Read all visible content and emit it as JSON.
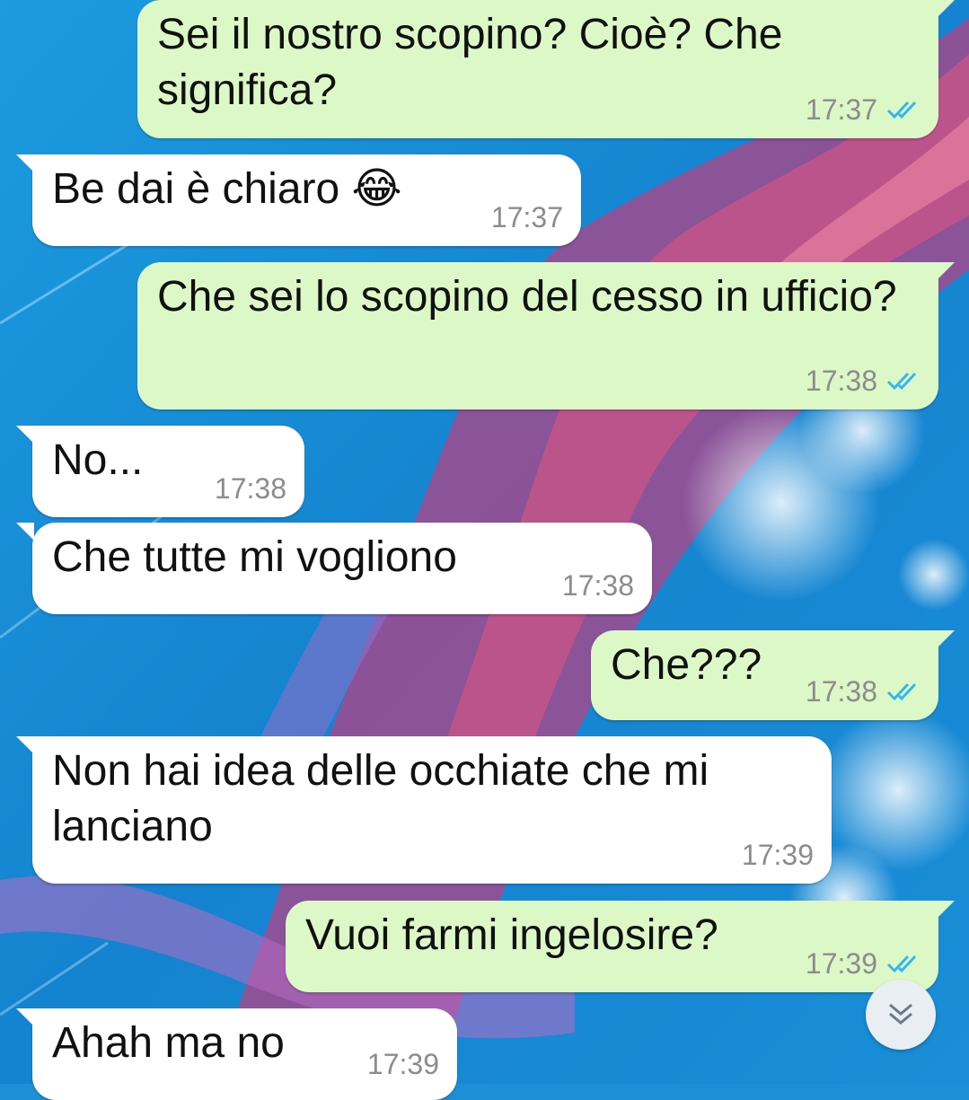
{
  "colors": {
    "outgoing_bubble": "#dcf8c6",
    "incoming_bubble": "#ffffff",
    "read_ticks": "#34b7f1",
    "timestamp": "#8c8c8c"
  },
  "messages": [
    {
      "direction": "outgoing",
      "text": "Sei il nostro scopino? Cioè? Che significa?",
      "time": "17:37",
      "status": "read"
    },
    {
      "direction": "incoming",
      "text": "Be dai è chiaro 😂",
      "time": "17:37"
    },
    {
      "direction": "outgoing",
      "text": "Che sei lo scopino del cesso in ufficio?",
      "time": "17:38",
      "status": "read"
    },
    {
      "direction": "incoming",
      "text": "No...",
      "time": "17:38"
    },
    {
      "direction": "incoming",
      "text": "Che tutte mi vogliono",
      "time": "17:38"
    },
    {
      "direction": "outgoing",
      "text": "Che???",
      "time": "17:38",
      "status": "read"
    },
    {
      "direction": "incoming",
      "text": "Non hai idea delle occhiate che mi lanciano",
      "time": "17:39"
    },
    {
      "direction": "outgoing",
      "text": "Vuoi farmi ingelosire?",
      "time": "17:39",
      "status": "read"
    },
    {
      "direction": "incoming",
      "text": "Ahah ma no",
      "time": "17:39"
    }
  ],
  "icons": {
    "read_receipt": "double-check-icon",
    "scroll_down": "double-chevron-down-icon"
  }
}
